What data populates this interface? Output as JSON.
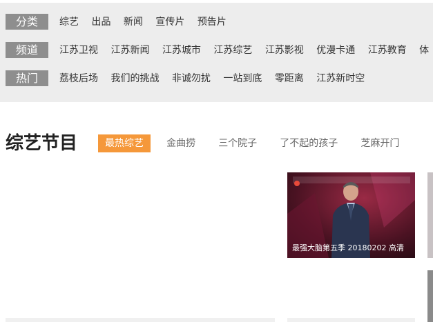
{
  "filters": {
    "category": {
      "tag": "分类",
      "items": [
        "综艺",
        "出品",
        "新闻",
        "宣传片",
        "预告片"
      ]
    },
    "channel": {
      "tag": "频道",
      "items": [
        "江苏卫视",
        "江苏新闻",
        "江苏城市",
        "江苏综艺",
        "江苏影视",
        "优漫卡通",
        "江苏教育",
        "体"
      ]
    },
    "hot": {
      "tag": "热门",
      "items": [
        "荔枝后场",
        "我们的挑战",
        "非诚勿扰",
        "一站到底",
        "零距离",
        "江苏新时空"
      ]
    }
  },
  "section": {
    "title": "综艺节目",
    "tabs": [
      "最热综艺",
      "金曲捞",
      "三个院子",
      "了不起的孩子",
      "芝麻开门"
    ],
    "active_tab": "最热综艺"
  },
  "cards": [
    {
      "caption": "最强大脑第五季 20180202 高清"
    }
  ],
  "colors": {
    "accent": "#f5983a",
    "tag_bg": "#8e8e8e",
    "panel_bg": "#ededed"
  }
}
